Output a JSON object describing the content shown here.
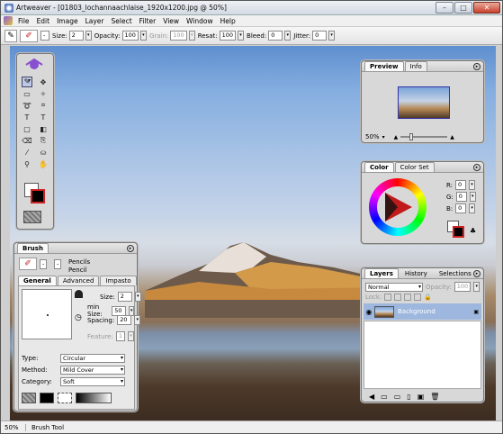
{
  "app": {
    "title": "Artweaver - [01803_lochannaachlaise_1920x1200.jpg @ 50%]"
  },
  "menu": [
    "File",
    "Edit",
    "Image",
    "Layer",
    "Select",
    "Filter",
    "View",
    "Window",
    "Help"
  ],
  "options": {
    "size_label": "Size:",
    "size": "2",
    "opacity_label": "Opacity:",
    "opacity": "100",
    "grain_label": "Grain:",
    "grain": "100",
    "resat_label": "Resat:",
    "resat": "100",
    "bleed_label": "Bleed:",
    "bleed": "0",
    "jitter_label": "Jitter:",
    "jitter": "0",
    "dash": "-"
  },
  "preview": {
    "tabs": [
      "Preview",
      "Info"
    ],
    "zoom": "50%"
  },
  "color": {
    "tabs": [
      "Color",
      "Color Set"
    ],
    "r_label": "R:",
    "g_label": "G:",
    "b_label": "B:",
    "r": "0",
    "g": "0",
    "b": "0",
    "primary": "#000000",
    "secondary": "#ffffff"
  },
  "layers": {
    "tabs": [
      "Layers",
      "History",
      "Selections"
    ],
    "blend": "Normal",
    "opacity_label": "Opacity:",
    "opacity": "100",
    "lock_label": "Lock:",
    "layer_name": "Background"
  },
  "brush": {
    "title": "Brush",
    "category": "Pencils",
    "variant": "Pencil",
    "tabs": [
      "General",
      "Advanced",
      "Impasto"
    ],
    "size_label": "Size:",
    "size": "2",
    "minsize_label": "min Size:",
    "minsize": "50",
    "spacing_label": "Spacing:",
    "spacing": "20",
    "feature_label": "Feature:",
    "feature": "1",
    "type_label": "Type:",
    "type": "Circular",
    "method_label": "Method:",
    "method": "Mild Cover",
    "cat_label": "Category:",
    "cat": "Soft"
  },
  "status": {
    "zoom": "50%",
    "tool": "Brush Tool"
  }
}
